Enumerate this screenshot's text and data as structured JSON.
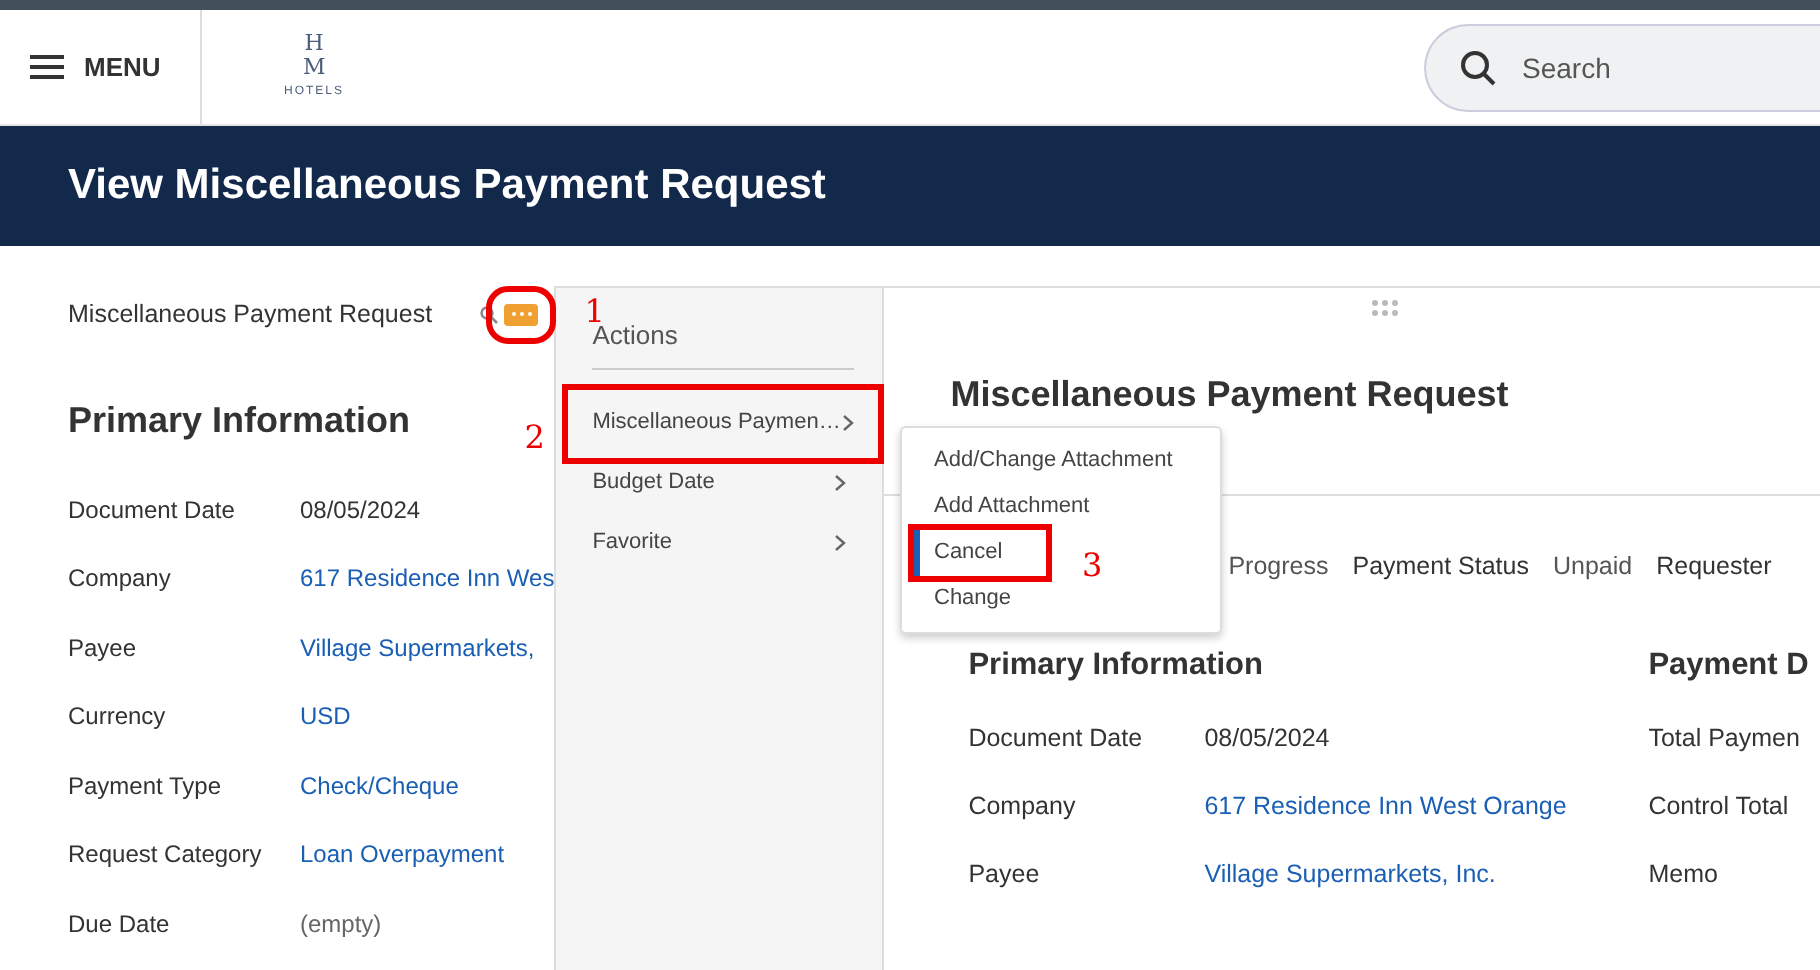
{
  "header": {
    "menu_label": "MENU",
    "logo_mark": "HM",
    "logo_text": "HOTELS",
    "search_placeholder": "Search"
  },
  "page_title": "View Miscellaneous Payment Request",
  "page": {
    "subject": "Miscellaneous Payment Request",
    "actions_button": {
      "annotation": "1"
    },
    "section_title": "Primary Information",
    "fields": [
      {
        "label": "Document Date",
        "value": "08/05/2024",
        "kind": "text"
      },
      {
        "label": "Company",
        "value": "617 Residence Inn Wes",
        "kind": "link"
      },
      {
        "label": "Payee",
        "value": "Village Supermarkets,",
        "kind": "link"
      },
      {
        "label": "Currency",
        "value": "USD",
        "kind": "link"
      },
      {
        "label": "Payment Type",
        "value": "Check/Cheque",
        "kind": "link"
      },
      {
        "label": "Request Category",
        "value": "Loan Overpayment",
        "kind": "link"
      },
      {
        "label": "Due Date",
        "value": "(empty)",
        "kind": "empty"
      }
    ]
  },
  "actions_panel": {
    "title": "Actions",
    "items": [
      {
        "label": "Miscellaneous Paymen…",
        "annotation": "2"
      },
      {
        "label": "Budget Date"
      },
      {
        "label": "Favorite"
      }
    ]
  },
  "submenu": {
    "items": [
      {
        "label": "Add/Change Attachment",
        "selected": false
      },
      {
        "label": "Add Attachment",
        "selected": false
      },
      {
        "label": "Cancel",
        "selected": true,
        "annotation": "3"
      },
      {
        "label": "Change",
        "selected": false
      }
    ]
  },
  "detail_panel": {
    "title": "Miscellaneous Payment Request",
    "status": [
      {
        "text": "Progress",
        "kind": "value"
      },
      {
        "text": "Payment Status",
        "kind": "label"
      },
      {
        "text": "Unpaid",
        "kind": "value"
      },
      {
        "text": "Requester",
        "kind": "label"
      }
    ],
    "sections": [
      {
        "title": "Primary Information",
        "fields": [
          {
            "label": "Document Date",
            "value": "08/05/2024",
            "kind": "text"
          },
          {
            "label": "Company",
            "value": "617 Residence Inn West Orange",
            "kind": "link"
          },
          {
            "label": "Payee",
            "value": "Village Supermarkets, Inc.",
            "kind": "link"
          }
        ]
      },
      {
        "title": "Payment D",
        "fields": [
          {
            "label": "Total Paymen"
          },
          {
            "label": "Control Total"
          },
          {
            "label": "Memo"
          }
        ]
      }
    ]
  }
}
